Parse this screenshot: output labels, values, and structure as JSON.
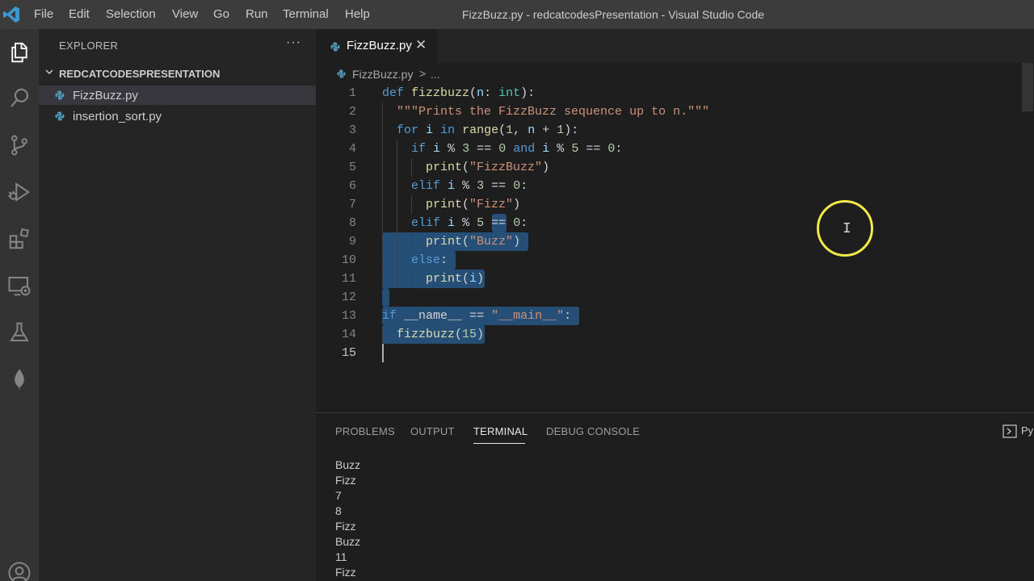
{
  "window": {
    "title": "FizzBuzz.py - redcatcodesPresentation - Visual Studio Code",
    "menu": [
      "File",
      "Edit",
      "Selection",
      "View",
      "Go",
      "Run",
      "Terminal",
      "Help"
    ]
  },
  "activity_bar": {
    "icons": [
      "explorer-icon",
      "search-icon",
      "source-control-icon",
      "run-debug-icon",
      "extensions-icon",
      "remote-explorer-icon",
      "testing-icon",
      "mongodb-icon",
      "account-icon"
    ]
  },
  "sidebar": {
    "title": "EXPLORER",
    "more": "···",
    "folder": "REDCATCODESPRESENTATION",
    "files": [
      {
        "name": "FizzBuzz.py",
        "selected": true
      },
      {
        "name": "insertion_sort.py",
        "selected": false
      }
    ]
  },
  "editor": {
    "tab_label": "FizzBuzz.py",
    "breadcrumb": {
      "file": "FizzBuzz.py",
      "separator": ">",
      "more": "..."
    },
    "current_line": 15,
    "line_numbers": [
      "1",
      "2",
      "3",
      "4",
      "5",
      "6",
      "7",
      "8",
      "9",
      "10",
      "11",
      "12",
      "13",
      "14",
      "15"
    ],
    "code_lines": [
      "def fizzbuzz(n: int):",
      "  \"\"\"Prints the FizzBuzz sequence up to n.\"\"\"",
      "  for i in range(1, n + 1):",
      "    if i % 3 == 0 and i % 5 == 0:",
      "      print(\"FizzBuzz\")",
      "    elif i % 3 == 0:",
      "      print(\"Fizz\")",
      "    elif i % 5 == 0:",
      "      print(\"Buzz\")",
      "    else:",
      "      print(i)",
      "",
      "if __name__ == \"__main__\":",
      "  fizzbuzz(15)",
      ""
    ],
    "colors": {
      "selection": "#264f78",
      "keyword": "#569cd6",
      "function": "#dcdcaa",
      "string": "#ce9178"
    }
  },
  "panel": {
    "tabs": [
      "PROBLEMS",
      "OUTPUT",
      "TERMINAL",
      "DEBUG CONSOLE"
    ],
    "active_tab": "TERMINAL",
    "shell_label": "Py",
    "terminal_output": [
      "Buzz",
      "Fizz",
      "7",
      "8",
      "Fizz",
      "Buzz",
      "11",
      "Fizz"
    ]
  },
  "cursor_highlight_color": "#f3e94a"
}
